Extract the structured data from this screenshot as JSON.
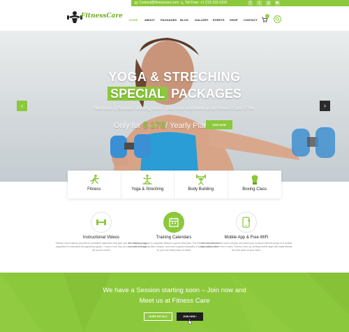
{
  "topbar": {
    "email": "Contact@fitnesscare.com",
    "phone": "Toll Free: +1 212-232-2316",
    "social_icons": [
      "facebook-icon",
      "twitter-icon",
      "google-plus-icon",
      "youtube-icon"
    ],
    "social_glyphs": [
      "f",
      "t",
      "g",
      "▶"
    ]
  },
  "brand": {
    "name": "FitnessCare",
    "accent_color": "#8cc83c"
  },
  "nav": {
    "items": [
      "HOME",
      "ABOUT",
      "PACKAGES",
      "BLOG",
      "GALLERY",
      "EVENTS",
      "SHOP",
      "CONTACT"
    ],
    "active": "HOME",
    "cart_count": "0"
  },
  "hero": {
    "title_line1": "YOGA & STRECHING",
    "title_highlight": "SPECIAL",
    "title_rest": "PACKAGES",
    "subtitle": "We have a Session starting soon – Join now and Meet us at Fitness Care GYM",
    "price_prefix": "Only for",
    "price_amount": "$ 178",
    "price_suffix": "/ Yearly Plan",
    "cta": "JOIN NOW",
    "prev_arrow": "‹",
    "next_arrow": "›"
  },
  "categories": [
    {
      "label": "Fitness",
      "icon": "runner-icon"
    },
    {
      "label": "Yoga & Streching",
      "icon": "yoga-pose-icon"
    },
    {
      "label": "Body Building",
      "icon": "weightlifter-icon"
    },
    {
      "label": "Boxing Class",
      "icon": "boxing-glove-icon"
    }
  ],
  "features": [
    {
      "title": "Instructional Videos",
      "icon": "dumbbell-icon",
      "description": "Fitness Care trainers provide fun printable calendars that give you the means to stay organized & motivated throughout program. Cross of one day at a time and see how far you've come!"
    },
    {
      "title": "Training Calendars",
      "icon": "calendar-icon",
      "description": "No training program is complete without a good meal plan. Put Fitness care trainers provide a shopping lists, recipes, and even a great examples of weekly meal plans so you can easily stay on track!"
    },
    {
      "title": "Mobile App & Free WiFi",
      "icon": "mobile-wifi-icon",
      "description": "Choose your perfect work out plan and track your workout with the press of a mobile app button, when ever u want. Fitness Care up coming mobile apps will make fitness fit in the palm of your hand."
    }
  ],
  "banner": {
    "line1": "We have a Session starting soon – Join now and",
    "line2": "Meet us at Fitness Care",
    "more_details": "MORE DETAILS",
    "join_now": "JOIN NOW ›"
  }
}
